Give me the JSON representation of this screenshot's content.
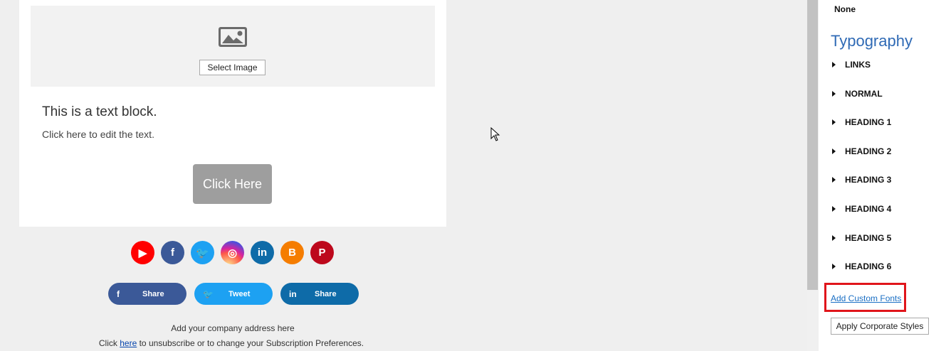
{
  "email": {
    "select_image_label": "Select Image",
    "text_block_title": "This is a text block.",
    "text_block_body": "Click here to edit the text.",
    "cta_label": "Click Here",
    "social_icons": [
      {
        "name": "youtube",
        "glyph": "▶",
        "color": "#ff0000"
      },
      {
        "name": "facebook",
        "glyph": "f",
        "color": "#3b5998"
      },
      {
        "name": "twitter",
        "glyph": "🐦",
        "color": "#1da1f2"
      },
      {
        "name": "instagram",
        "glyph": "◎",
        "color": "#c13584"
      },
      {
        "name": "linkedin",
        "glyph": "in",
        "color": "#0e6ba8"
      },
      {
        "name": "blogger",
        "glyph": "B",
        "color": "#f57d00"
      },
      {
        "name": "pinterest",
        "glyph": "P",
        "color": "#bd081c"
      }
    ],
    "share_buttons": [
      {
        "name": "facebook",
        "glyph": "f",
        "label": "Share",
        "color": "#3b5998"
      },
      {
        "name": "twitter",
        "glyph": "🐦",
        "label": "Tweet",
        "color": "#1da1f2"
      },
      {
        "name": "linkedin",
        "glyph": "in",
        "label": "Share",
        "color": "#0e6ba8"
      }
    ],
    "footer": {
      "address": "Add your company address here",
      "unsub_prefix": "Click ",
      "unsub_link": "here",
      "unsub_suffix": " to unsubscribe or to change your Subscription Preferences."
    }
  },
  "panel": {
    "none_label": "None",
    "typography_title": "Typography",
    "typography_items": [
      "LINKS",
      "NORMAL",
      "HEADING 1",
      "HEADING 2",
      "HEADING 3",
      "HEADING 4",
      "HEADING 5",
      "HEADING 6"
    ],
    "add_custom_fonts": "Add Custom Fonts",
    "apply_corporate_styles": "Apply Corporate Styles"
  }
}
